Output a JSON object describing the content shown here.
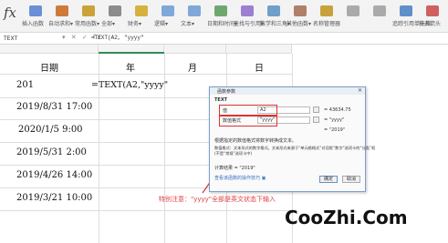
{
  "ribbon": {
    "fx": "fx",
    "items": [
      {
        "label": "插入函数",
        "color": "#6b8fd6"
      },
      {
        "label": "自动求和▾",
        "color": "#d07a3a"
      },
      {
        "label": "常用函数▾",
        "color": "#c9a23a"
      },
      {
        "label": "全部▾",
        "color": "#8c8c8c"
      },
      {
        "label": "财务▾",
        "color": "#d7b13e"
      },
      {
        "label": "逻辑▾",
        "color": "#7fa7d9"
      },
      {
        "label": "文本▾",
        "color": "#7fa7d9"
      },
      {
        "label": "日期和时间▾",
        "color": "#6fa86f"
      },
      {
        "label": "查找与引用▾",
        "color": "#9c7fd1"
      },
      {
        "label": "数学和三角▾",
        "color": "#6fa0c9"
      },
      {
        "label": "其他函数▾",
        "color": "#b07f6a"
      },
      {
        "label": "名称管理器",
        "color": "#c7a23b"
      },
      {
        "label": "",
        "color": "#aaaaaa"
      },
      {
        "label": "",
        "color": "#aaaaaa"
      },
      {
        "label": "追踪引用单元格",
        "color": "#5f8fc9"
      },
      {
        "label": "移去箭头",
        "color": "#d06060"
      }
    ]
  },
  "formula_bar": {
    "name_box": "TEXT",
    "icons": "▾ ✕ ✓ fx",
    "formula": "=TEXT(A2, \"yyyy\""
  },
  "sheet": {
    "headers": [
      "日期",
      "年",
      "月",
      "日"
    ],
    "rows": [
      {
        "a": "201",
        "b": "=TEXT(A2,\"yyyy\""
      },
      {
        "a": "2019/8/31 17:00",
        "b": ""
      },
      {
        "a": "2020/1/5 9:00",
        "b": ""
      },
      {
        "a": "2019/5/31 2:00",
        "b": ""
      },
      {
        "a": "2019/4/26 14:00",
        "b": ""
      },
      {
        "a": "2019/3/21 10:00",
        "b": ""
      }
    ]
  },
  "dialog": {
    "title": "函数参数",
    "close": "✕",
    "function": "TEXT",
    "arg1_label": "值",
    "arg1_value": "A2",
    "arg1_result": "= 43634.75",
    "arg2_label": "数值格式",
    "arg2_value": "\"yyyy\"",
    "arg2_result": "= \"yyyy\"",
    "summary_result": "= \"2019\"",
    "desc1": "根据指定的数值格式将数字转换成文本。",
    "desc2": "数值格式：文本形式的数字格式。文本形式来源于“单元格格式”对话框“数字”选项卡的“分类”框",
    "desc3": "(不是“常规”选项卡中)",
    "calc_result": "计算结果 = \"2019\"",
    "help_link": "查看该函数的操作技巧 ▣",
    "ok": "确定",
    "cancel": "取消"
  },
  "annotation": "特别注意：\"yyyy\"全部是英文状态下输入",
  "watermark": "CooZhi.Com",
  "colors": {
    "accent_green": "#2e8b57",
    "annotation_red": "#e03030",
    "dialog_border": "#7aa0cc"
  }
}
